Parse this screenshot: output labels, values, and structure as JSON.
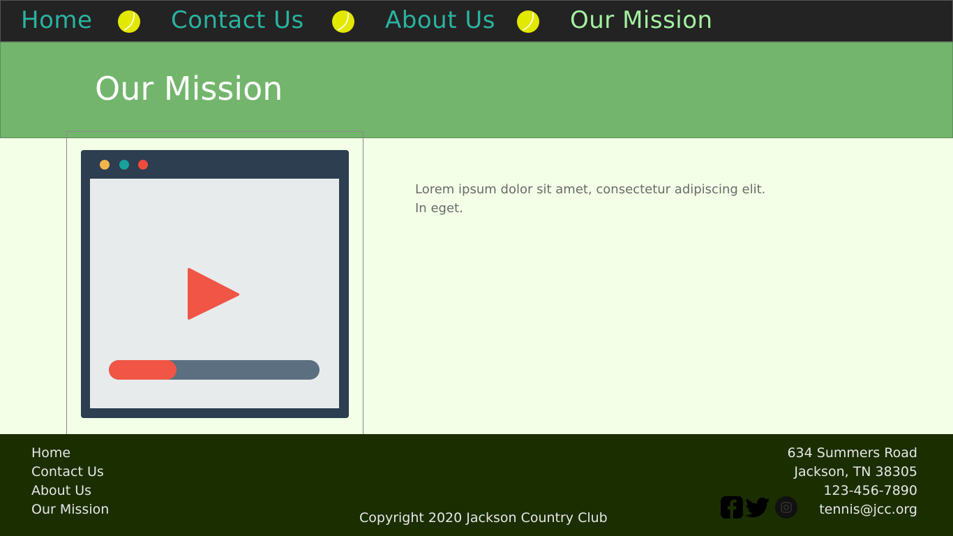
{
  "nav": {
    "items": [
      {
        "label": "Home",
        "active": false
      },
      {
        "label": "Contact Us",
        "active": false
      },
      {
        "label": "About Us",
        "active": false
      },
      {
        "label": "Our Mission",
        "active": true
      }
    ],
    "separator_icon": "tennis-ball-icon"
  },
  "banner": {
    "title": "Our Mission"
  },
  "media": {
    "window_dot_colors": [
      "#f3b54a",
      "#1aa19c",
      "#ee4b3e"
    ],
    "play_icon": "play-icon",
    "progress_fraction": 0.32
  },
  "content": {
    "text": "Lorem ipsum dolor sit amet, consectetur adipiscing elit. In eget."
  },
  "footer": {
    "links": [
      "Home",
      "Contact Us",
      "About Us",
      "Our Mission"
    ],
    "copyright": "Copyright 2020 Jackson Country Club",
    "social_icons": [
      "facebook-icon",
      "twitter-icon",
      "instagram-icon"
    ],
    "address_line1": "634 Summers Road",
    "address_line2": "Jackson, TN 38305",
    "phone": "123-456-7890",
    "email": "tennis@jcc.org"
  },
  "colors": {
    "nav_bg": "#232323",
    "nav_link": "#2ab3a0",
    "nav_active": "#a4f0a0",
    "banner_bg": "#73b56c",
    "page_bg": "#f3ffe6",
    "footer_bg": "#1b2e00",
    "tennis_ball": "#e3e800",
    "accent_red": "#f05545"
  }
}
